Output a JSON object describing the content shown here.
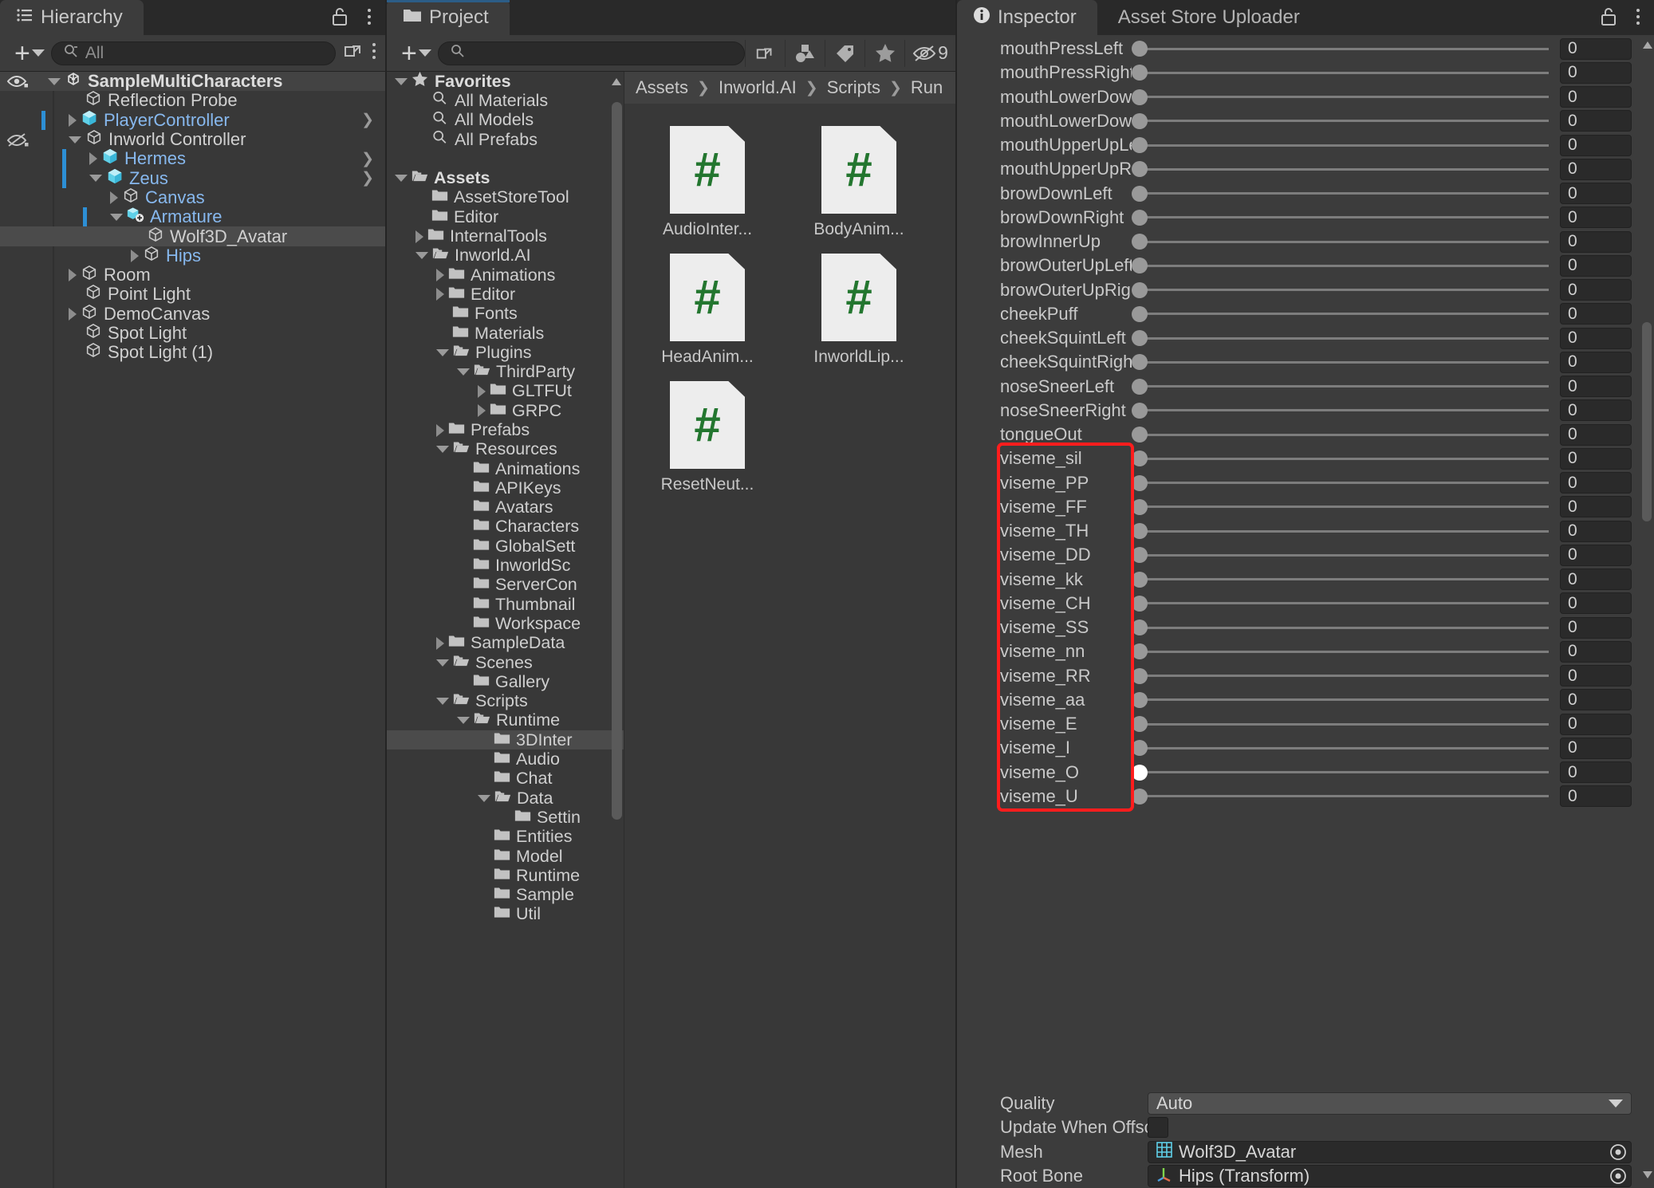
{
  "hierarchy": {
    "tab_label": "Hierarchy",
    "search_placeholder": "All",
    "items": [
      {
        "label": "SampleMultiCharacters",
        "depth": 0,
        "twisty": "open",
        "style": "bold",
        "icon": "prefab-root-icon",
        "selected": false,
        "root": true,
        "eye": true,
        "bluebar": false,
        "chevron": false
      },
      {
        "label": "Reflection Probe",
        "depth": 1,
        "twisty": "none",
        "style": "white",
        "icon": "gameobject-icon",
        "selected": false,
        "root": false,
        "eye": false,
        "bluebar": false,
        "chevron": false
      },
      {
        "label": "PlayerController",
        "depth": 1,
        "twisty": "closed",
        "style": "blue",
        "icon": "prefab-icon",
        "selected": false,
        "root": false,
        "eye": false,
        "bluebar": true,
        "chevron": true
      },
      {
        "label": "Inworld Controller",
        "depth": 1,
        "twisty": "open",
        "style": "white",
        "icon": "gameobject-icon",
        "selected": false,
        "root": false,
        "eye": "off",
        "bluebar": false,
        "chevron": false
      },
      {
        "label": "Hermes",
        "depth": 2,
        "twisty": "closed",
        "style": "blue",
        "icon": "prefab-icon",
        "selected": false,
        "root": false,
        "eye": false,
        "bluebar": true,
        "chevron": true
      },
      {
        "label": "Zeus",
        "depth": 2,
        "twisty": "open",
        "style": "blue",
        "icon": "prefab-icon",
        "selected": false,
        "root": false,
        "eye": false,
        "bluebar": true,
        "chevron": true
      },
      {
        "label": "Canvas",
        "depth": 3,
        "twisty": "closed",
        "style": "blue",
        "icon": "gameobject-icon",
        "selected": false,
        "root": false,
        "eye": false,
        "bluebar": false,
        "chevron": false
      },
      {
        "label": "Armature",
        "depth": 3,
        "twisty": "open",
        "style": "blue",
        "icon": "prefab-variant-icon",
        "selected": false,
        "root": false,
        "eye": false,
        "bluebar": true,
        "chevron": false
      },
      {
        "label": "Wolf3D_Avatar",
        "depth": 4,
        "twisty": "none",
        "style": "white",
        "icon": "gameobject-icon",
        "selected": true,
        "root": false,
        "eye": false,
        "bluebar": false,
        "chevron": false
      },
      {
        "label": "Hips",
        "depth": 4,
        "twisty": "closed",
        "style": "blue",
        "icon": "gameobject-icon",
        "selected": false,
        "root": false,
        "eye": false,
        "bluebar": false,
        "chevron": false
      },
      {
        "label": "Room",
        "depth": 1,
        "twisty": "closed",
        "style": "white",
        "icon": "gameobject-icon",
        "selected": false,
        "root": false,
        "eye": false,
        "bluebar": false,
        "chevron": false
      },
      {
        "label": "Point Light",
        "depth": 1,
        "twisty": "none",
        "style": "white",
        "icon": "gameobject-icon",
        "selected": false,
        "root": false,
        "eye": false,
        "bluebar": false,
        "chevron": false
      },
      {
        "label": "DemoCanvas",
        "depth": 1,
        "twisty": "closed",
        "style": "white",
        "icon": "gameobject-icon",
        "selected": false,
        "root": false,
        "eye": false,
        "bluebar": false,
        "chevron": false
      },
      {
        "label": "Spot Light",
        "depth": 1,
        "twisty": "none",
        "style": "white",
        "icon": "gameobject-icon",
        "selected": false,
        "root": false,
        "eye": false,
        "bluebar": false,
        "chevron": false
      },
      {
        "label": "Spot Light (1)",
        "depth": 1,
        "twisty": "none",
        "style": "white",
        "icon": "gameobject-icon",
        "selected": false,
        "root": false,
        "eye": false,
        "bluebar": false,
        "chevron": false
      }
    ]
  },
  "project": {
    "tab_label": "Project",
    "search_placeholder": "",
    "filter_count": "9",
    "breadcrumb": [
      "Assets",
      "Inworld.AI",
      "Scripts",
      "Run"
    ],
    "tree": [
      {
        "label": "Favorites",
        "depth": 0,
        "twisty": "open",
        "icon": "star-icon",
        "bold": true,
        "selected": false
      },
      {
        "label": "All Materials",
        "depth": 1,
        "twisty": "none",
        "icon": "search-icon",
        "bold": false,
        "selected": false
      },
      {
        "label": "All Models",
        "depth": 1,
        "twisty": "none",
        "icon": "search-icon",
        "bold": false,
        "selected": false
      },
      {
        "label": "All Prefabs",
        "depth": 1,
        "twisty": "none",
        "icon": "search-icon",
        "bold": false,
        "selected": false
      },
      {
        "label": "",
        "depth": 0,
        "twisty": "none",
        "icon": "spacer",
        "bold": false,
        "selected": false
      },
      {
        "label": "Assets",
        "depth": 0,
        "twisty": "open",
        "icon": "folder-open-icon",
        "bold": true,
        "selected": false
      },
      {
        "label": "AssetStoreTool",
        "depth": 1,
        "twisty": "none",
        "icon": "folder-icon",
        "bold": false,
        "selected": false
      },
      {
        "label": "Editor",
        "depth": 1,
        "twisty": "none",
        "icon": "folder-icon",
        "bold": false,
        "selected": false
      },
      {
        "label": "InternalTools",
        "depth": 1,
        "twisty": "closed",
        "icon": "folder-icon",
        "bold": false,
        "selected": false
      },
      {
        "label": "Inworld.AI",
        "depth": 1,
        "twisty": "open",
        "icon": "folder-open-icon",
        "bold": false,
        "selected": false
      },
      {
        "label": "Animations",
        "depth": 2,
        "twisty": "closed",
        "icon": "folder-icon",
        "bold": false,
        "selected": false
      },
      {
        "label": "Editor",
        "depth": 2,
        "twisty": "closed",
        "icon": "folder-icon",
        "bold": false,
        "selected": false
      },
      {
        "label": "Fonts",
        "depth": 2,
        "twisty": "none",
        "icon": "folder-icon",
        "bold": false,
        "selected": false
      },
      {
        "label": "Materials",
        "depth": 2,
        "twisty": "none",
        "icon": "folder-icon",
        "bold": false,
        "selected": false
      },
      {
        "label": "Plugins",
        "depth": 2,
        "twisty": "open",
        "icon": "folder-open-icon",
        "bold": false,
        "selected": false
      },
      {
        "label": "ThirdParty",
        "depth": 3,
        "twisty": "open",
        "icon": "folder-open-icon",
        "bold": false,
        "selected": false
      },
      {
        "label": "GLTFUt",
        "depth": 4,
        "twisty": "closed",
        "icon": "folder-icon",
        "bold": false,
        "selected": false
      },
      {
        "label": "GRPC",
        "depth": 4,
        "twisty": "closed",
        "icon": "folder-icon",
        "bold": false,
        "selected": false
      },
      {
        "label": "Prefabs",
        "depth": 2,
        "twisty": "closed",
        "icon": "folder-icon",
        "bold": false,
        "selected": false
      },
      {
        "label": "Resources",
        "depth": 2,
        "twisty": "open",
        "icon": "folder-open-icon",
        "bold": false,
        "selected": false
      },
      {
        "label": "Animations",
        "depth": 3,
        "twisty": "none",
        "icon": "folder-icon",
        "bold": false,
        "selected": false
      },
      {
        "label": "APIKeys",
        "depth": 3,
        "twisty": "none",
        "icon": "folder-icon",
        "bold": false,
        "selected": false
      },
      {
        "label": "Avatars",
        "depth": 3,
        "twisty": "none",
        "icon": "folder-icon",
        "bold": false,
        "selected": false
      },
      {
        "label": "Characters",
        "depth": 3,
        "twisty": "none",
        "icon": "folder-icon",
        "bold": false,
        "selected": false
      },
      {
        "label": "GlobalSett",
        "depth": 3,
        "twisty": "none",
        "icon": "folder-icon",
        "bold": false,
        "selected": false
      },
      {
        "label": "InworldSc",
        "depth": 3,
        "twisty": "none",
        "icon": "folder-icon",
        "bold": false,
        "selected": false
      },
      {
        "label": "ServerCon",
        "depth": 3,
        "twisty": "none",
        "icon": "folder-icon",
        "bold": false,
        "selected": false
      },
      {
        "label": "Thumbnail",
        "depth": 3,
        "twisty": "none",
        "icon": "folder-icon",
        "bold": false,
        "selected": false
      },
      {
        "label": "Workspace",
        "depth": 3,
        "twisty": "none",
        "icon": "folder-icon",
        "bold": false,
        "selected": false
      },
      {
        "label": "SampleData",
        "depth": 2,
        "twisty": "closed",
        "icon": "folder-icon",
        "bold": false,
        "selected": false
      },
      {
        "label": "Scenes",
        "depth": 2,
        "twisty": "open",
        "icon": "folder-open-icon",
        "bold": false,
        "selected": false
      },
      {
        "label": "Gallery",
        "depth": 3,
        "twisty": "none",
        "icon": "folder-icon",
        "bold": false,
        "selected": false
      },
      {
        "label": "Scripts",
        "depth": 2,
        "twisty": "open",
        "icon": "folder-open-icon",
        "bold": false,
        "selected": false
      },
      {
        "label": "Runtime",
        "depth": 3,
        "twisty": "open",
        "icon": "folder-open-icon",
        "bold": false,
        "selected": false
      },
      {
        "label": "3DInter",
        "depth": 4,
        "twisty": "none",
        "icon": "folder-icon",
        "bold": false,
        "selected": true
      },
      {
        "label": "Audio",
        "depth": 4,
        "twisty": "none",
        "icon": "folder-icon",
        "bold": false,
        "selected": false
      },
      {
        "label": "Chat",
        "depth": 4,
        "twisty": "none",
        "icon": "folder-icon",
        "bold": false,
        "selected": false
      },
      {
        "label": "Data",
        "depth": 4,
        "twisty": "open",
        "icon": "folder-open-icon",
        "bold": false,
        "selected": false
      },
      {
        "label": "Settin",
        "depth": 5,
        "twisty": "none",
        "icon": "folder-icon",
        "bold": false,
        "selected": false
      },
      {
        "label": "Entities",
        "depth": 4,
        "twisty": "none",
        "icon": "folder-icon",
        "bold": false,
        "selected": false
      },
      {
        "label": "Model",
        "depth": 4,
        "twisty": "none",
        "icon": "folder-icon",
        "bold": false,
        "selected": false
      },
      {
        "label": "Runtime",
        "depth": 4,
        "twisty": "none",
        "icon": "folder-icon",
        "bold": false,
        "selected": false
      },
      {
        "label": "Sample",
        "depth": 4,
        "twisty": "none",
        "icon": "folder-icon",
        "bold": false,
        "selected": false
      },
      {
        "label": "Util",
        "depth": 4,
        "twisty": "none",
        "icon": "folder-icon",
        "bold": false,
        "selected": false
      }
    ],
    "assets": [
      {
        "name": "AudioInter...",
        "icon": "csharp-script-icon"
      },
      {
        "name": "BodyAnim...",
        "icon": "csharp-script-icon"
      },
      {
        "name": "HeadAnim...",
        "icon": "csharp-script-icon"
      },
      {
        "name": "InworldLip...",
        "icon": "csharp-script-icon"
      },
      {
        "name": "ResetNeut...",
        "icon": "csharp-script-icon"
      }
    ]
  },
  "inspector": {
    "tab_label": "Inspector",
    "tab2_label": "Asset Store Uploader",
    "blendshapes": [
      {
        "name": "mouthPressLeft",
        "value": "0",
        "knob": "normal",
        "highlight": false
      },
      {
        "name": "mouthPressRight",
        "value": "0",
        "knob": "normal",
        "highlight": false
      },
      {
        "name": "mouthLowerDownl",
        "value": "0",
        "knob": "normal",
        "highlight": false
      },
      {
        "name": "mouthLowerDownl",
        "value": "0",
        "knob": "normal",
        "highlight": false
      },
      {
        "name": "mouthUpperUpLeft",
        "value": "0",
        "knob": "normal",
        "highlight": false
      },
      {
        "name": "mouthUpperUpRigl",
        "value": "0",
        "knob": "normal",
        "highlight": false
      },
      {
        "name": "browDownLeft",
        "value": "0",
        "knob": "normal",
        "highlight": false
      },
      {
        "name": "browDownRight",
        "value": "0",
        "knob": "normal",
        "highlight": false
      },
      {
        "name": "browInnerUp",
        "value": "0",
        "knob": "normal",
        "highlight": false
      },
      {
        "name": "browOuterUpLeft",
        "value": "0",
        "knob": "normal",
        "highlight": false
      },
      {
        "name": "browOuterUpRight",
        "value": "0",
        "knob": "normal",
        "highlight": false
      },
      {
        "name": "cheekPuff",
        "value": "0",
        "knob": "normal",
        "highlight": false
      },
      {
        "name": "cheekSquintLeft",
        "value": "0",
        "knob": "normal",
        "highlight": false
      },
      {
        "name": "cheekSquintRight",
        "value": "0",
        "knob": "normal",
        "highlight": false
      },
      {
        "name": "noseSneerLeft",
        "value": "0",
        "knob": "normal",
        "highlight": false
      },
      {
        "name": "noseSneerRight",
        "value": "0",
        "knob": "normal",
        "highlight": false
      },
      {
        "name": "tongueOut",
        "value": "0",
        "knob": "normal",
        "highlight": false
      },
      {
        "name": "viseme_sil",
        "value": "0",
        "knob": "normal",
        "highlight": true
      },
      {
        "name": "viseme_PP",
        "value": "0",
        "knob": "normal",
        "highlight": true
      },
      {
        "name": "viseme_FF",
        "value": "0",
        "knob": "normal",
        "highlight": true
      },
      {
        "name": "viseme_TH",
        "value": "0",
        "knob": "normal",
        "highlight": true
      },
      {
        "name": "viseme_DD",
        "value": "0",
        "knob": "normal",
        "highlight": true
      },
      {
        "name": "viseme_kk",
        "value": "0",
        "knob": "normal",
        "highlight": true
      },
      {
        "name": "viseme_CH",
        "value": "0",
        "knob": "normal",
        "highlight": true
      },
      {
        "name": "viseme_SS",
        "value": "0",
        "knob": "normal",
        "highlight": true
      },
      {
        "name": "viseme_nn",
        "value": "0",
        "knob": "normal",
        "highlight": true
      },
      {
        "name": "viseme_RR",
        "value": "0",
        "knob": "normal",
        "highlight": true
      },
      {
        "name": "viseme_aa",
        "value": "0",
        "knob": "normal",
        "highlight": true
      },
      {
        "name": "viseme_E",
        "value": "0",
        "knob": "normal",
        "highlight": true
      },
      {
        "name": "viseme_I",
        "value": "0",
        "knob": "normal",
        "highlight": true
      },
      {
        "name": "viseme_O",
        "value": "0",
        "knob": "active",
        "highlight": true
      },
      {
        "name": "viseme_U",
        "value": "0",
        "knob": "normal",
        "highlight": true
      }
    ],
    "quality_label": "Quality",
    "quality_value": "Auto",
    "update_offscreen_label": "Update When Offscre",
    "update_offscreen_checked": false,
    "mesh_label": "Mesh",
    "mesh_value": "Wolf3D_Avatar",
    "root_bone_label": "Root Bone",
    "root_bone_value": "Hips (Transform)"
  },
  "colors": {
    "highlight_red": "#ff1d1d",
    "selection_blue": "#2d8fd5",
    "prefab_blue": "#87b8ee",
    "script_green": "#23762f",
    "panel_bg": "#383838",
    "inspector_bg": "#3c3c3c"
  }
}
